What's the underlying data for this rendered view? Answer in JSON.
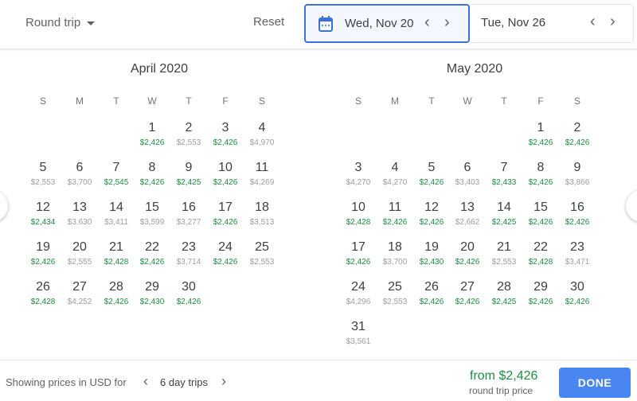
{
  "header": {
    "trip_type": "Round trip",
    "reset": "Reset",
    "departure": "Wed, Nov 20",
    "return": "Tue, Nov 26"
  },
  "colors": {
    "accent": "#3d72d6",
    "low_price": "#1e8e3e",
    "regular_price": "#9aa0a6",
    "done_button": "#4a86f0"
  },
  "weekdays": [
    "S",
    "M",
    "T",
    "W",
    "T",
    "F",
    "S"
  ],
  "months": [
    {
      "title": "April 2020",
      "year": 2020,
      "month": 4,
      "days": [
        [
          "$2,426",
          1
        ],
        [
          "$2,553",
          0
        ],
        [
          "$2,426",
          1
        ],
        [
          "$4,970",
          0
        ],
        [
          "$2,553",
          0
        ],
        [
          "$3,700",
          0
        ],
        [
          "$2,545",
          1
        ],
        [
          "$2,426",
          1
        ],
        [
          "$2,425",
          1
        ],
        [
          "$2,426",
          1
        ],
        [
          "$4,269",
          0
        ],
        [
          "$2,434",
          1
        ],
        [
          "$3,630",
          0
        ],
        [
          "$3,411",
          0
        ],
        [
          "$3,599",
          0
        ],
        [
          "$3,277",
          0
        ],
        [
          "$2,426",
          1
        ],
        [
          "$3,513",
          0
        ],
        [
          "$2,426",
          1
        ],
        [
          "$2,555",
          0
        ],
        [
          "$2,428",
          1
        ],
        [
          "$2,426",
          1
        ],
        [
          "$3,714",
          0
        ],
        [
          "$2,426",
          1
        ],
        [
          "$2,553",
          0
        ],
        [
          "$2,428",
          1
        ],
        [
          "$4,252",
          0
        ],
        [
          "$2,426",
          1
        ],
        [
          "$2,430",
          1
        ],
        [
          "$2,426",
          1
        ]
      ]
    },
    {
      "title": "May 2020",
      "year": 2020,
      "month": 5,
      "days": [
        [
          "$2,426",
          1
        ],
        [
          "$2,426",
          1
        ],
        [
          "$4,270",
          0
        ],
        [
          "$4,270",
          0
        ],
        [
          "$2,426",
          1
        ],
        [
          "$3,403",
          0
        ],
        [
          "$2,433",
          1
        ],
        [
          "$2,426",
          1
        ],
        [
          "$3,866",
          0
        ],
        [
          "$2,428",
          1
        ],
        [
          "$2,426",
          1
        ],
        [
          "$2,426",
          1
        ],
        [
          "$2,662",
          0
        ],
        [
          "$2,425",
          1
        ],
        [
          "$2,426",
          1
        ],
        [
          "$2,426",
          1
        ],
        [
          "$2,426",
          1
        ],
        [
          "$3,700",
          0
        ],
        [
          "$2,430",
          1
        ],
        [
          "$2,426",
          1
        ],
        [
          "$2,553",
          0
        ],
        [
          "$2,428",
          1
        ],
        [
          "$3,471",
          0
        ],
        [
          "$4,296",
          0
        ],
        [
          "$2,553",
          0
        ],
        [
          "$2,426",
          1
        ],
        [
          "$2,426",
          1
        ],
        [
          "$2,425",
          1
        ],
        [
          "$2,426",
          1
        ],
        [
          "$2,426",
          1
        ],
        [
          "$3,561",
          0
        ]
      ]
    }
  ],
  "footer": {
    "showing": "Showing prices in USD for",
    "trip_length": "6 day trips",
    "from_price": "from $2,426",
    "price_note": "round trip price",
    "done": "DONE"
  }
}
